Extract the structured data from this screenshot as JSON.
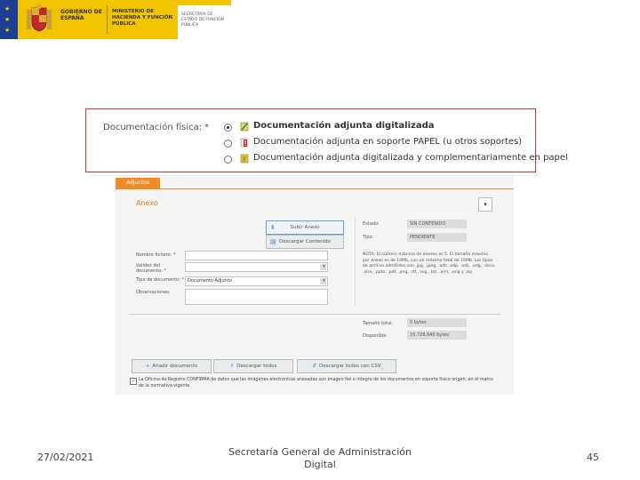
{
  "header": {
    "gobierno": "GOBIERNO DE ESPAÑA",
    "ministerio": "MINISTERIO DE HACIENDA Y FUNCIÓN PÚBLICA",
    "secretaria": "SECRETARÍA DE ESTADO DE FUNCIÓN PÚBLICA",
    "brand_color": "#f2c400"
  },
  "documentation": {
    "label": "Documentación física: *",
    "options": [
      {
        "label": "Documentación adjunta digitalizada",
        "selected": true,
        "icon": "scan-document-icon"
      },
      {
        "label": "Documentación adjunta en soporte PAPEL (u otros soportes)",
        "selected": false,
        "icon": "paper-alert-icon"
      },
      {
        "label": "Documentación adjunta digitalizada y complementariamente en papel",
        "selected": false,
        "icon": "document-paper-icon"
      }
    ],
    "border_color": "#d9303a"
  },
  "form": {
    "tab": "Adjuntos",
    "section_title": "Anexo",
    "upload_button": "Subir Anexo",
    "view_button": "Descargar Contenido",
    "fields": {
      "file_name_label": "Nombre fichero: *",
      "validity_label": "Validez del documento: *",
      "doc_type_label": "Tipo de documento: *",
      "doc_type_value": "Documento Adjunto",
      "observations_label": "Observaciones:"
    },
    "info": {
      "status_label": "Estado:",
      "status_value": "SIN CONTENIDO",
      "type_label": "Tipo:",
      "type_value": "PENDIENTE",
      "note": "NOTA: El número máximo de anexos es 5. El tamaño máximo por anexo es de 10Mb, con un máximo total de 15Mb. Los tipos de archivo admitidos son .jpg, .jpeg, .odt, .odp, .ods, .odg, .docx, .xlsx, .pptx, .pdf, .png, .rtf, .svg, .txt, .xml, .xsig y .zip",
      "total_size_label": "Tamaño total:",
      "total_size_value": "0 bytes",
      "available_label": "Disponible:",
      "available_value": "15.728.640 bytes"
    },
    "actions": {
      "add_label": "Añadir documento",
      "download_all_label": "Descargar todos",
      "download_csv_label": "Descargar todos con CSV"
    },
    "legal_text": "La Oficina de Registro CONFIRMA de datos que las imágenes electrónicas anexadas son imagen fiel e íntegra de los documentos en soporte físico origen, en el marco de la normativa vigente",
    "accent_color": "#f08b2a"
  },
  "footer": {
    "date": "27/02/2021",
    "center": "Secretaría General de Administración Digital",
    "page": "45"
  }
}
